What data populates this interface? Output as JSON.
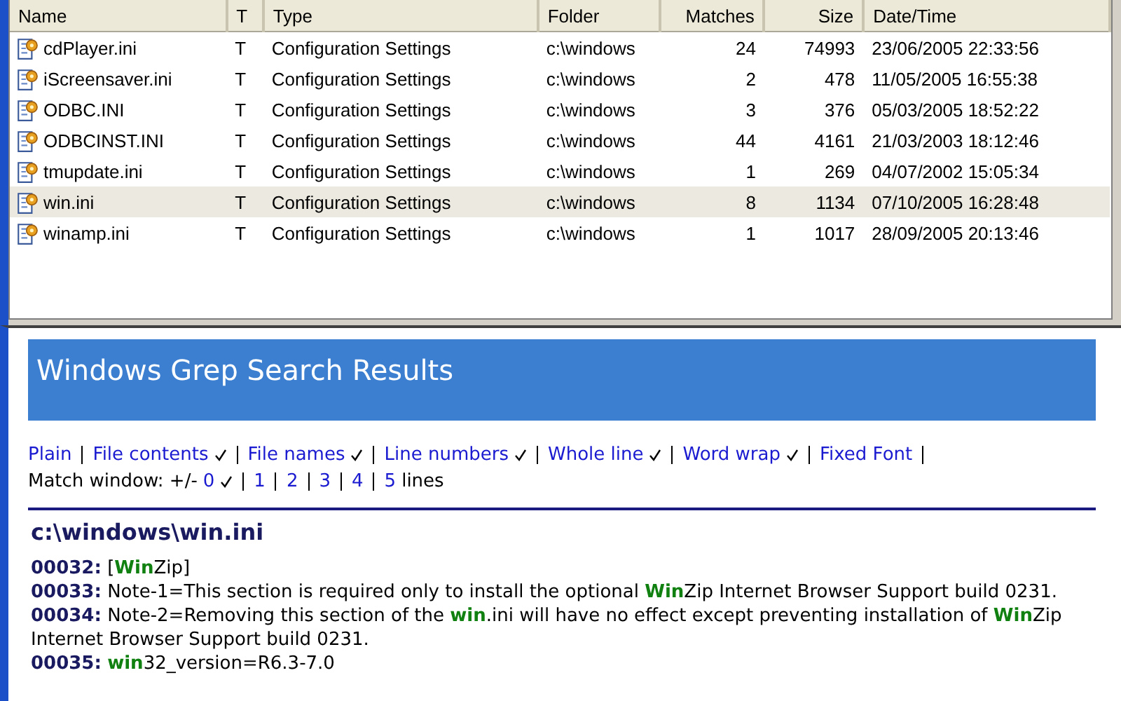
{
  "file_list": {
    "columns": [
      "Name",
      "T",
      "Type",
      "Folder",
      "Matches",
      "Size",
      "Date/Time"
    ],
    "rows": [
      {
        "cells": [
          "cdPlayer.ini",
          "T",
          "Configuration Settings",
          "c:\\windows",
          "24",
          "74993",
          "23/06/2005 22:33:56"
        ],
        "selected": false
      },
      {
        "cells": [
          "iScreensaver.ini",
          "T",
          "Configuration Settings",
          "c:\\windows",
          "2",
          "478",
          "11/05/2005 16:55:38"
        ],
        "selected": false
      },
      {
        "cells": [
          "ODBC.INI",
          "T",
          "Configuration Settings",
          "c:\\windows",
          "3",
          "376",
          "05/03/2005 18:52:22"
        ],
        "selected": false
      },
      {
        "cells": [
          "ODBCINST.INI",
          "T",
          "Configuration Settings",
          "c:\\windows",
          "44",
          "4161",
          "21/03/2003 18:12:46"
        ],
        "selected": false
      },
      {
        "cells": [
          "tmupdate.ini",
          "T",
          "Configuration Settings",
          "c:\\windows",
          "1",
          "269",
          "04/07/2002 15:05:34"
        ],
        "selected": false
      },
      {
        "cells": [
          "win.ini",
          "T",
          "Configuration Settings",
          "c:\\windows",
          "8",
          "1134",
          "07/10/2005 16:28:48"
        ],
        "selected": true
      },
      {
        "cells": [
          "winamp.ini",
          "T",
          "Configuration Settings",
          "c:\\windows",
          "1",
          "1017",
          "28/09/2005 20:13:46"
        ],
        "selected": false
      }
    ]
  },
  "results": {
    "title": "Windows Grep Search Results",
    "options": [
      {
        "label": "Plain",
        "checked": false
      },
      {
        "label": "File contents",
        "checked": true
      },
      {
        "label": "File names",
        "checked": true
      },
      {
        "label": "Line numbers",
        "checked": true
      },
      {
        "label": "Whole line",
        "checked": true
      },
      {
        "label": "Word wrap",
        "checked": true
      },
      {
        "label": "Fixed Font",
        "checked": false
      }
    ],
    "match_window": {
      "label": "Match window: +/-",
      "choices": [
        {
          "label": "0",
          "selected": true
        },
        {
          "label": "1",
          "selected": false
        },
        {
          "label": "2",
          "selected": false
        },
        {
          "label": "3",
          "selected": false
        },
        {
          "label": "4",
          "selected": false
        },
        {
          "label": "5",
          "selected": false
        }
      ],
      "suffix": "lines"
    },
    "file_heading": "c:\\windows\\win.ini",
    "lines": [
      "**00032:** [**Win**Zip]",
      "**00033:** Note-1=This section is required only to install the optional **Win**Zip Internet Browser Support build 0231.",
      "**00034:** Note-2=Removing this section of the **win**.ini will have no effect except preventing installation of **Win**Zip Internet Browser Support build 0231.",
      "**00035:** **win**32_version=R6.3-7.0"
    ]
  }
}
